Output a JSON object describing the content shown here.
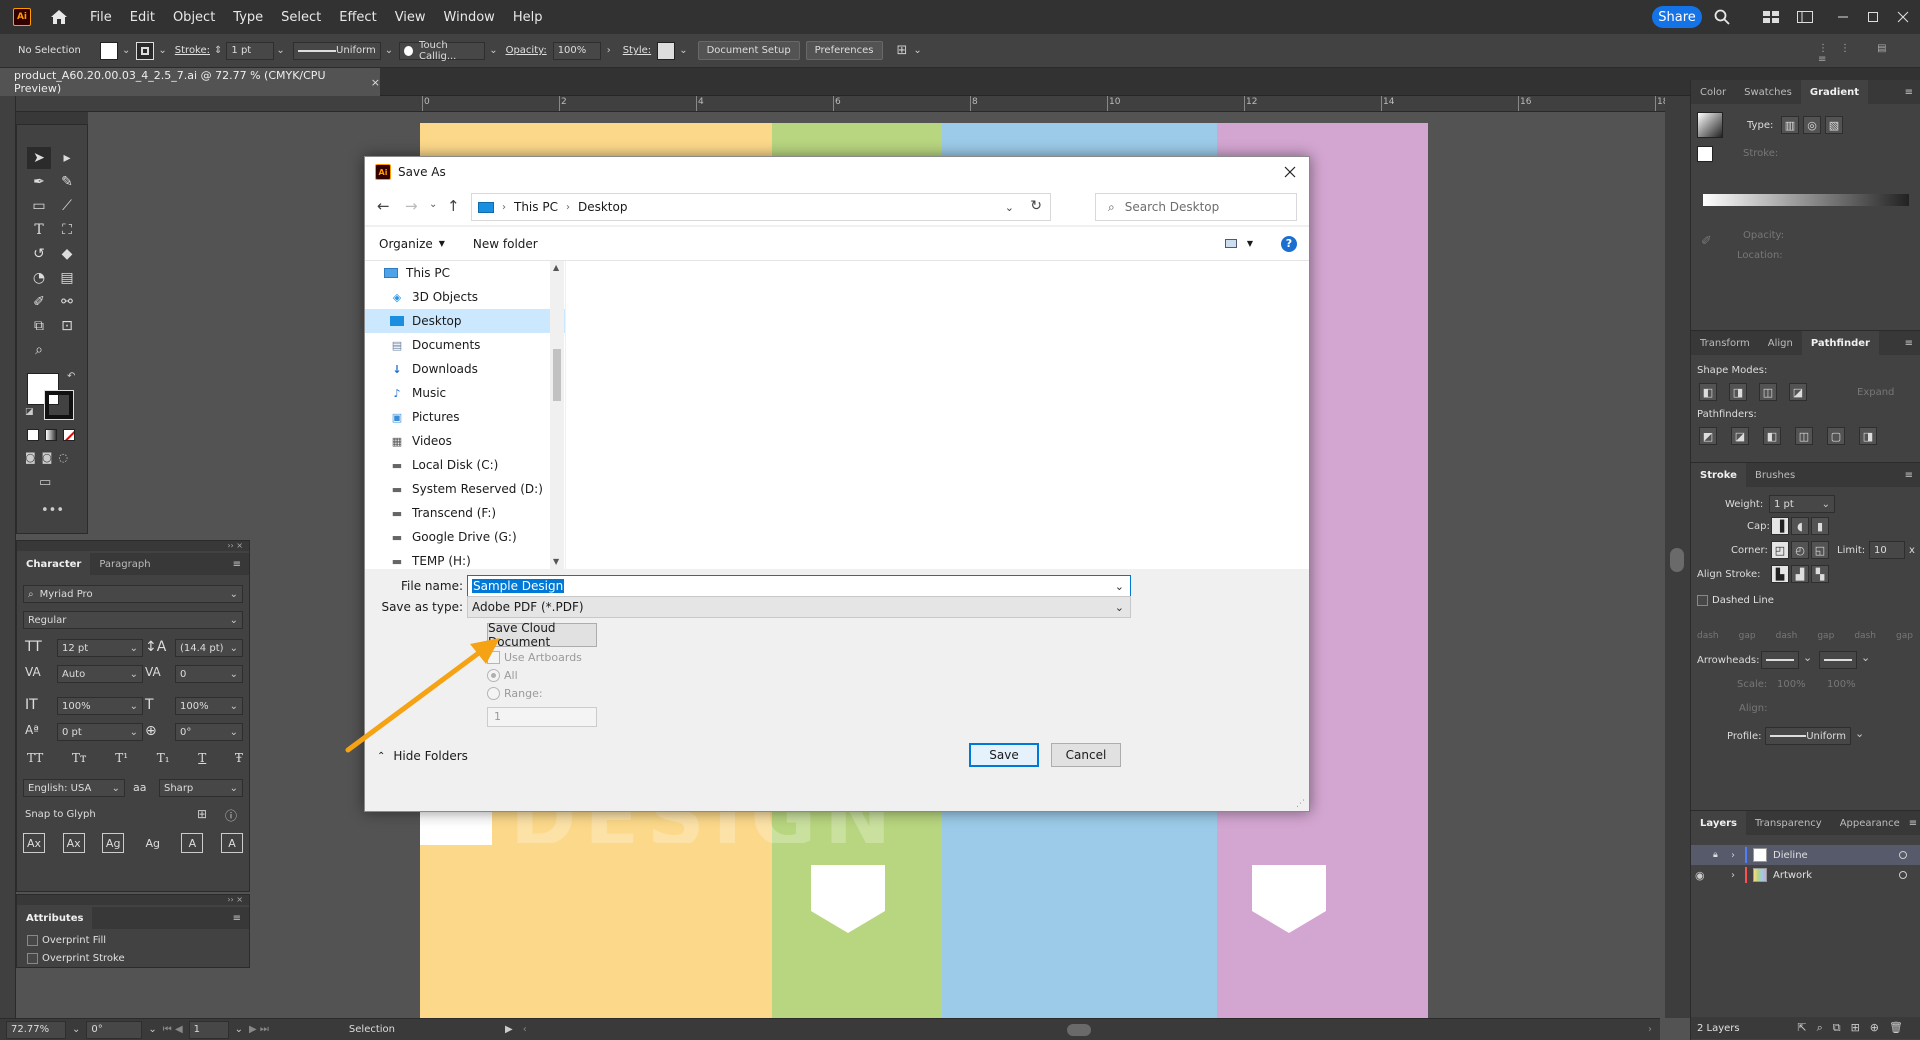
{
  "app": {
    "logo": "Ai",
    "menu": [
      "File",
      "Edit",
      "Object",
      "Type",
      "Select",
      "Effect",
      "View",
      "Window",
      "Help"
    ],
    "share_label": "Share",
    "icons": [
      "home-icon",
      "search-icon",
      "arrange-documents-icon",
      "workspace-icon",
      "minimize-icon",
      "maximize-icon",
      "close-icon"
    ]
  },
  "controlbar": {
    "selection": "No Selection",
    "stroke_label": "Stroke:",
    "stroke_value": "1 pt",
    "stroke_profile": "Uniform",
    "brush": "Touch Callig...",
    "opacity_label": "Opacity:",
    "opacity_value": "100%",
    "style_label": "Style:",
    "doc_setup": "Document Setup",
    "preferences": "Preferences"
  },
  "document": {
    "tab_title": "product_A60.20.00.03_4_2.5_7.ai @ 72.77 % (CMYK/CPU Preview)",
    "ruler_ticks": [
      "4",
      "2",
      "0",
      "2",
      "4",
      "6",
      "8",
      "10",
      "12",
      "14",
      "16",
      "18"
    ],
    "colors": {
      "yellow": "#fcd98a",
      "green": "#b8d67f",
      "blue": "#9ccbe9",
      "pink": "#d3a6d1"
    },
    "background_text": "DESIGN"
  },
  "dialog": {
    "title": "Save As",
    "breadcrumb": [
      "This PC",
      "Desktop"
    ],
    "search_placeholder": "Search Desktop",
    "organize": "Organize",
    "new_folder": "New folder",
    "nav_items": [
      {
        "label": "This PC",
        "icon": "computer-icon"
      },
      {
        "label": "3D Objects",
        "icon": "3d-objects-icon"
      },
      {
        "label": "Desktop",
        "icon": "desktop-icon",
        "selected": true
      },
      {
        "label": "Documents",
        "icon": "documents-icon"
      },
      {
        "label": "Downloads",
        "icon": "downloads-icon"
      },
      {
        "label": "Music",
        "icon": "music-icon"
      },
      {
        "label": "Pictures",
        "icon": "pictures-icon"
      },
      {
        "label": "Videos",
        "icon": "videos-icon"
      },
      {
        "label": "Local Disk (C:)",
        "icon": "drive-icon"
      },
      {
        "label": "System Reserved (D:)",
        "icon": "drive-icon"
      },
      {
        "label": "Transcend (F:)",
        "icon": "drive-icon"
      },
      {
        "label": "Google Drive (G:)",
        "icon": "drive-icon"
      },
      {
        "label": "TEMP (H:)",
        "icon": "drive-icon"
      }
    ],
    "file_name_label": "File name:",
    "file_name_value": "Sample Design",
    "save_type_label": "Save as type:",
    "save_type_value": "Adobe PDF (*.PDF)",
    "save_cloud": "Save Cloud Document",
    "use_artboards": "Use Artboards",
    "all_label": "All",
    "range_label": "Range:",
    "range_value": "1",
    "hide_folders": "Hide Folders",
    "save": "Save",
    "cancel": "Cancel"
  },
  "character_panel": {
    "tabs": [
      "Character",
      "Paragraph"
    ],
    "font": "Myriad Pro",
    "style": "Regular",
    "size": "12 pt",
    "leading": "(14.4 pt)",
    "kerning": "Auto",
    "tracking": "0",
    "vscale": "100%",
    "hscale": "100%",
    "baseline": "0 pt",
    "rotation": "0°",
    "language": "English: USA",
    "aa_label": "aa",
    "antialias": "Sharp",
    "snap": "Snap to Glyph",
    "text_toggles": [
      "TT",
      "Tт",
      "T¹",
      "T₁",
      "T",
      "Ŧ"
    ],
    "snap_icons": [
      "Ax",
      "Ax",
      "Ag",
      "Ag",
      "A",
      "A"
    ]
  },
  "attributes_panel": {
    "title": "Attributes",
    "overprint_fill": "Overprint Fill",
    "overprint_stroke": "Overprint Stroke"
  },
  "right": {
    "color_tabs": [
      "Color",
      "Swatches",
      "Gradient"
    ],
    "type_label": "Type:",
    "stroke_label": "Stroke:",
    "opacity_label": "Opacity:",
    "location_label": "Location:",
    "transform_tabs": [
      "Transform",
      "Align",
      "Pathfinder"
    ],
    "shape_modes": "Shape Modes:",
    "expand": "Expand",
    "pathfinders": "Pathfinders:",
    "stroke_tabs": [
      "Stroke",
      "Brushes"
    ],
    "weight_label": "Weight:",
    "weight_value": "1 pt",
    "cap_label": "Cap:",
    "corner_label": "Corner:",
    "limit_label": "Limit:",
    "limit_value": "10",
    "limit_unit": "x",
    "align_stroke_label": "Align Stroke:",
    "dashed_line": "Dashed Line",
    "dash_gap": [
      "dash",
      "gap",
      "dash",
      "gap",
      "dash",
      "gap"
    ],
    "arrowheads_label": "Arrowheads:",
    "scale_label": "Scale:",
    "scale_values": [
      "100%",
      "100%"
    ],
    "align_label": "Align:",
    "profile_label": "Profile:",
    "profile_value": "Uniform",
    "layer_tabs": [
      "Layers",
      "Transparency",
      "Appearance"
    ],
    "layers": [
      {
        "name": "Dieline",
        "color": "#4f7fff",
        "locked": true,
        "visible": false
      },
      {
        "name": "Artwork",
        "color": "#ff4f4f",
        "locked": false,
        "visible": true
      }
    ],
    "layer_count": "2 Layers"
  },
  "status": {
    "zoom": "72.77%",
    "rotation": "0°",
    "artboard": "1",
    "mode": "Selection"
  }
}
